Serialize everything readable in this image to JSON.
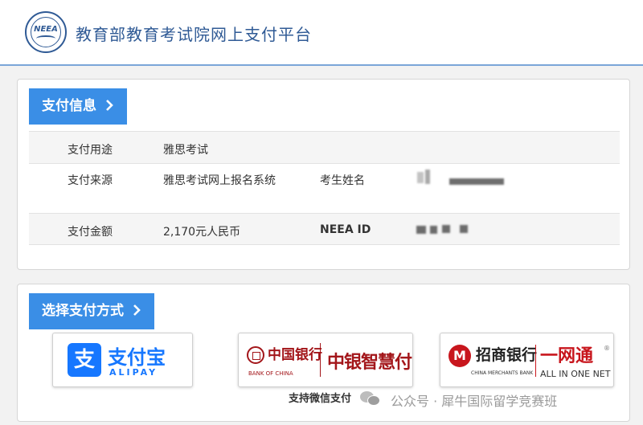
{
  "header": {
    "logo_text": "NEEA",
    "site_title": "教育部教育考试院网上支付平台"
  },
  "payment_info": {
    "section_label": "支付信息",
    "rows": [
      {
        "label": "支付用途",
        "value": "雅思考试"
      },
      {
        "label": "支付来源",
        "value": "雅思考试网上报名系统",
        "label2": "考生姓名",
        "value2_redacted": true
      },
      {
        "label": "支付金额",
        "value": "2,170元人民币",
        "label2": "NEEA ID",
        "value2_redacted": true
      }
    ]
  },
  "payment_methods": {
    "section_label": "选择支付方式",
    "alipay": {
      "icon_glyph": "支",
      "name_cn": "支付宝",
      "name_en": "ALIPAY"
    },
    "boc": {
      "name_cn": "中国银行",
      "name_en": "BANK OF CHINA",
      "product": "中银智慧付"
    },
    "cmb": {
      "name_cn": "招商银行",
      "name_en": "CHINA MERCHANTS BANK",
      "product": "一网通",
      "product_en": "ALL IN ONE NET",
      "registered": "®"
    },
    "wechat_note": "支持微信支付"
  },
  "watermark": {
    "text": "公众号 · 犀牛国际留学竞赛班"
  },
  "colors": {
    "brand_blue": "#2f5a95",
    "tab_blue": "#3a8ee6",
    "alipay_blue": "#1677ff",
    "boc_red": "#a3161a",
    "cmb_red": "#c8161d"
  }
}
